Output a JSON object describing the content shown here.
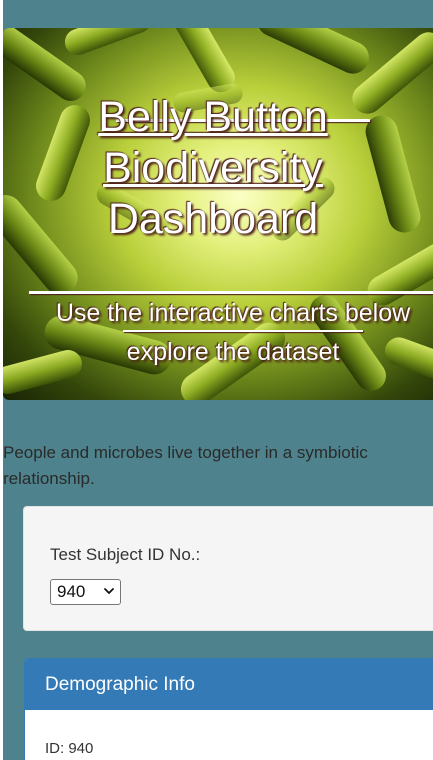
{
  "stray_markup": "/>",
  "header": {
    "title_line1": "Belly Button",
    "title_line2": "Biodiversity",
    "title_line3": "Dashboard",
    "subtitle_line1": "Use the interactive charts below",
    "subtitle_line2": "explore the dataset"
  },
  "intro": {
    "text": "People and microbes live together in a symbiotic relationship."
  },
  "selector": {
    "label": "Test Subject ID No.:",
    "selected_value": "940"
  },
  "demographic_panel": {
    "heading": "Demographic Info",
    "first_row": "ID: 940"
  },
  "colors": {
    "page_background": "#4e828c",
    "panel_primary": "#337ab7",
    "well_background": "#f5f5f5"
  }
}
